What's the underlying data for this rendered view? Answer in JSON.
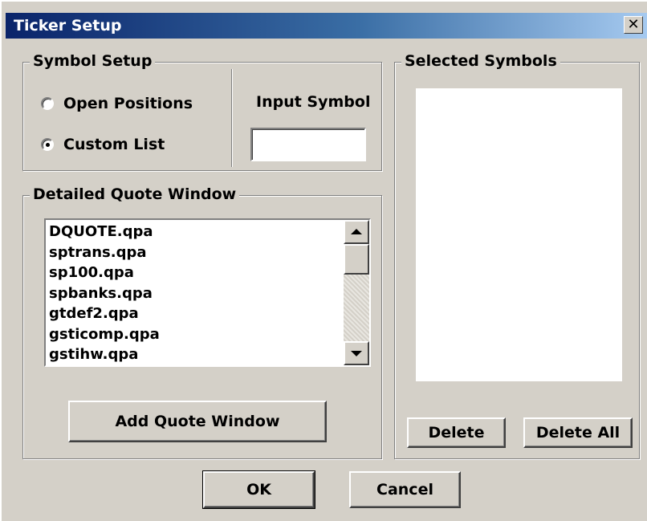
{
  "window": {
    "title": "Ticker Setup",
    "close_glyph": "✕"
  },
  "symbol_setup": {
    "legend": "Symbol Setup",
    "options": [
      {
        "label": "Open Positions",
        "checked": false
      },
      {
        "label": "Custom List",
        "checked": true
      }
    ],
    "input_label": "Input Symbol",
    "input_value": ""
  },
  "quote_window": {
    "legend": "Detailed Quote Window",
    "items": [
      "DQUOTE.qpa",
      "sptrans.qpa",
      "sp100.qpa",
      "spbanks.qpa",
      "gtdef2.qpa",
      "gsticomp.qpa",
      "gstihw.qpa"
    ],
    "add_button": "Add Quote Window"
  },
  "selected_symbols": {
    "legend": "Selected Symbols",
    "items": [],
    "delete_button": "Delete",
    "delete_all_button": "Delete All"
  },
  "footer": {
    "ok": "OK",
    "cancel": "Cancel"
  },
  "colors": {
    "face": "#d4d0c8",
    "title_start": "#0a246a",
    "title_end": "#a6caf0"
  }
}
